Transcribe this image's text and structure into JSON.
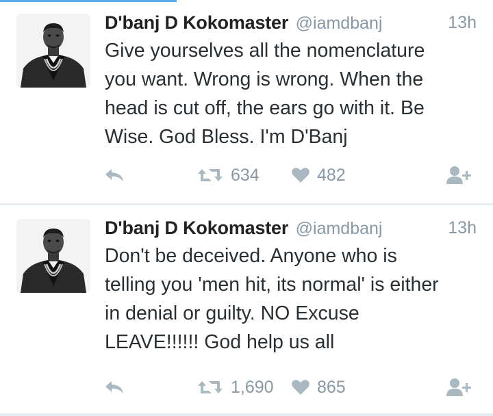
{
  "colors": {
    "accent": "#55acee",
    "meta": "#8899a6",
    "icon": "#aab8c2",
    "text": "#292f33",
    "name": "#222222",
    "divider": "#e8edf1"
  },
  "tweets": [
    {
      "display_name": "D'banj D Kokomaster",
      "handle": "@iamdbanj",
      "time": "13h",
      "text": "Give yourselves all the nomenclature\nyou want. Wrong is wrong. When the\nhead is cut off, the ears go with it. Be\nWise. God Bless. I'm D'Banj",
      "retweets": "634",
      "likes": "482",
      "icons": [
        "reply-icon",
        "retweet-icon",
        "heart-icon",
        "follow-icon"
      ]
    },
    {
      "display_name": "D'banj D Kokomaster",
      "handle": "@iamdbanj",
      "time": "13h",
      "text": "Don't be deceived.  Anyone who is\ntelling you 'men hit, its normal' is either\nin denial or guilty. NO Excuse\nLEAVE!!!!!! God help us all",
      "retweets": "1,690",
      "likes": "865",
      "icons": [
        "reply-icon",
        "retweet-icon",
        "heart-icon",
        "follow-icon"
      ]
    }
  ]
}
